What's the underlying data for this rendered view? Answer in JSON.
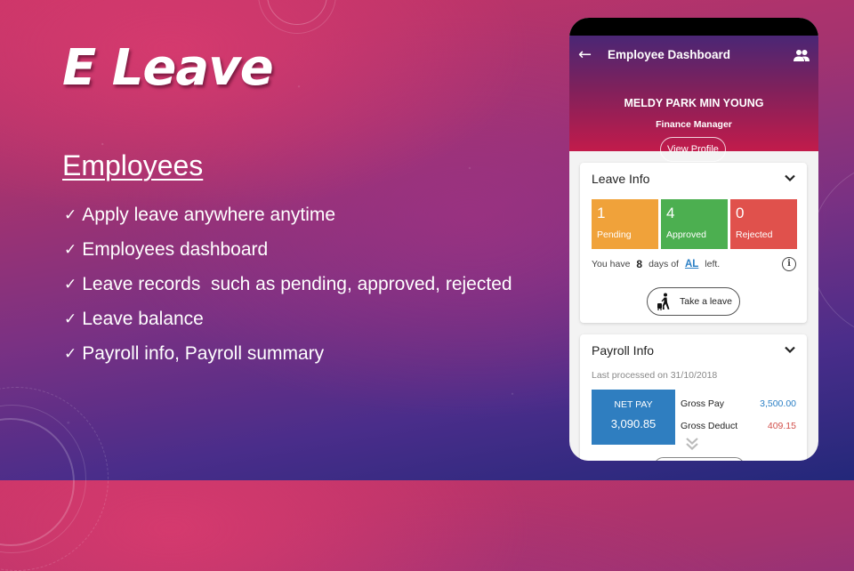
{
  "slide": {
    "title": "E Leave",
    "section_heading": "Employees",
    "check_glyph": "✓",
    "bullets": [
      "Apply leave anywhere anytime",
      "Employees dashboard",
      "Leave records  such as pending, approved, rejected",
      "Leave balance",
      "Payroll info, Payroll summary"
    ]
  },
  "app": {
    "header": {
      "back_icon": "←",
      "title": "Employee Dashboard",
      "employee_name": "MELDY PARK MIN YOUNG",
      "employee_role": "Finance Manager",
      "view_profile_label": "View Profile"
    },
    "leave_info": {
      "title": "Leave Info",
      "stats": [
        {
          "count": "1",
          "label": "Pending",
          "color": "#f0a23a"
        },
        {
          "count": "4",
          "label": "Approved",
          "color": "#4caf50"
        },
        {
          "count": "0",
          "label": "Rejected",
          "color": "#e0514c"
        }
      ],
      "balance_prefix": "You have",
      "balance_days": "8",
      "balance_middle": "days of",
      "balance_type": "AL",
      "balance_suffix": "left.",
      "info_icon": "i",
      "take_leave_label": "Take a leave"
    },
    "payroll_info": {
      "title": "Payroll Info",
      "last_processed": "Last processed on 31/10/2018",
      "net_pay_label": "NET PAY",
      "net_pay_value": "3,090.85",
      "gross_pay_label": "Gross Pay",
      "gross_pay_value": "3,500.00",
      "gross_deduct_label": "Gross Deduct",
      "gross_deduct_value": "409.15"
    }
  }
}
